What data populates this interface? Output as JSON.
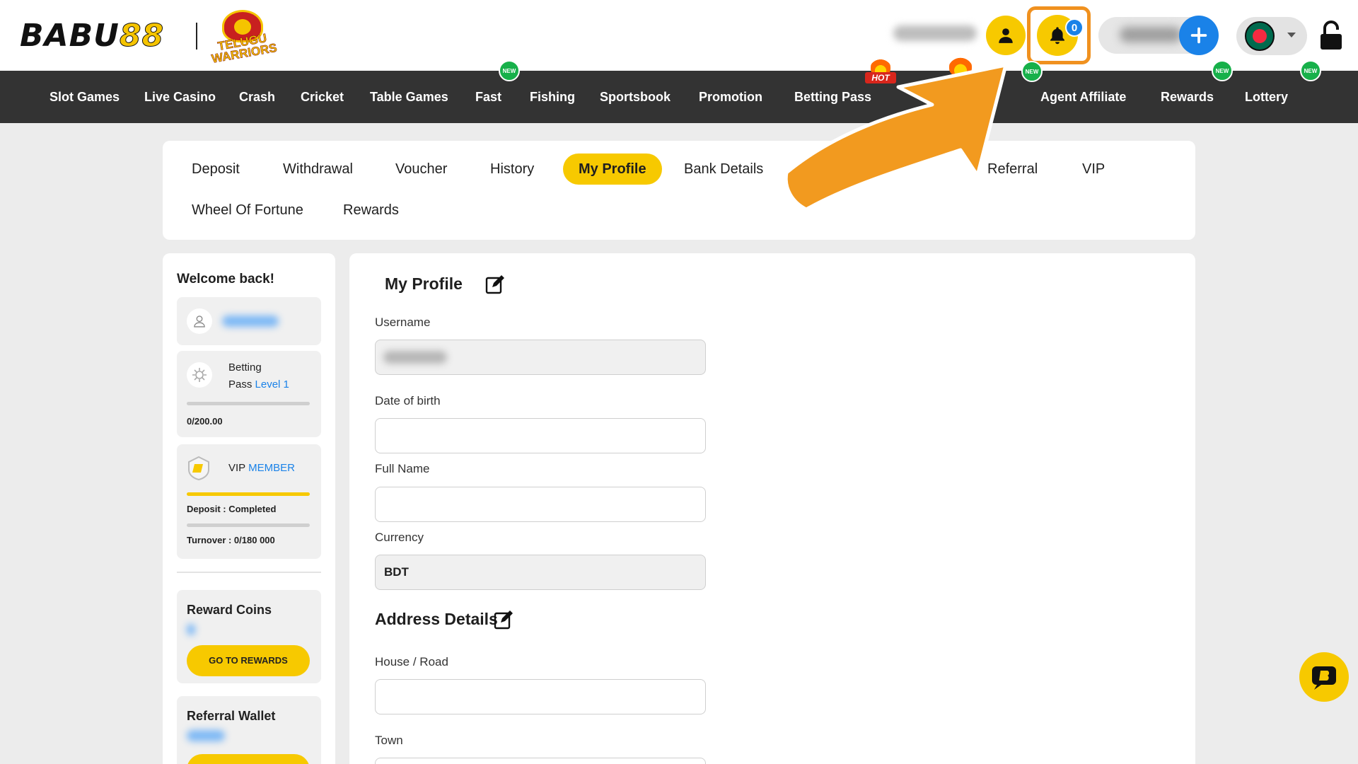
{
  "header": {
    "brand": "BABU",
    "brand_suffix": "88",
    "partner": "TELUGU WARRIORS",
    "notification_count": "0",
    "add_symbol": "+"
  },
  "nav": {
    "items": [
      {
        "label": "Slot Games"
      },
      {
        "label": "Live Casino"
      },
      {
        "label": "Crash"
      },
      {
        "label": "Cricket"
      },
      {
        "label": "Table Games"
      },
      {
        "label": "Fast",
        "badge": "NEW"
      },
      {
        "label": "Fishing"
      },
      {
        "label": "Sportsbook"
      },
      {
        "label": "Promotion"
      },
      {
        "label": "Betting Pass",
        "badge": "HOT"
      },
      {
        "label": "Agent Affiliate",
        "badge": "NEW"
      },
      {
        "label": "Rewards",
        "badge": "NEW"
      },
      {
        "label": "Lottery",
        "badge": "NEW"
      }
    ]
  },
  "tabs": {
    "items": [
      {
        "label": "Deposit"
      },
      {
        "label": "Withdrawal"
      },
      {
        "label": "Voucher"
      },
      {
        "label": "History"
      },
      {
        "label": "My Profile",
        "active": true
      },
      {
        "label": "Bank Details"
      },
      {
        "label": "Referral"
      },
      {
        "label": "VIP"
      },
      {
        "label": "Wheel Of Fortune"
      },
      {
        "label": "Rewards"
      }
    ]
  },
  "sidebar": {
    "welcome": "Welcome back!",
    "betting_pass": {
      "line1": "Betting",
      "line2": "Pass",
      "level": "Level 1",
      "progress_text": "0/200.00",
      "progress": 0
    },
    "vip": {
      "label": "VIP",
      "tier": "MEMBER",
      "deposit_text": "Deposit : Completed",
      "deposit_progress": 1.0,
      "turnover_text": "Turnover : 0/180 000",
      "turnover_progress": 0
    },
    "reward_coins": {
      "title": "Reward Coins",
      "button": "GO TO REWARDS"
    },
    "referral_wallet": {
      "title": "Referral Wallet"
    }
  },
  "profile": {
    "title": "My Profile",
    "fields": {
      "username_label": "Username",
      "dob_label": "Date of birth",
      "fullname_label": "Full Name",
      "currency_label": "Currency",
      "currency_value": "BDT"
    },
    "address": {
      "title": "Address Details",
      "house_label": "House / Road",
      "town_label": "Town"
    }
  },
  "colors": {
    "accent_yellow": "#f7c900",
    "nav_bg": "#333333",
    "link_blue": "#1a82e8",
    "badge_green": "#17b04a",
    "hot_red": "#d8261c",
    "highlight_orange": "#f0911f"
  }
}
